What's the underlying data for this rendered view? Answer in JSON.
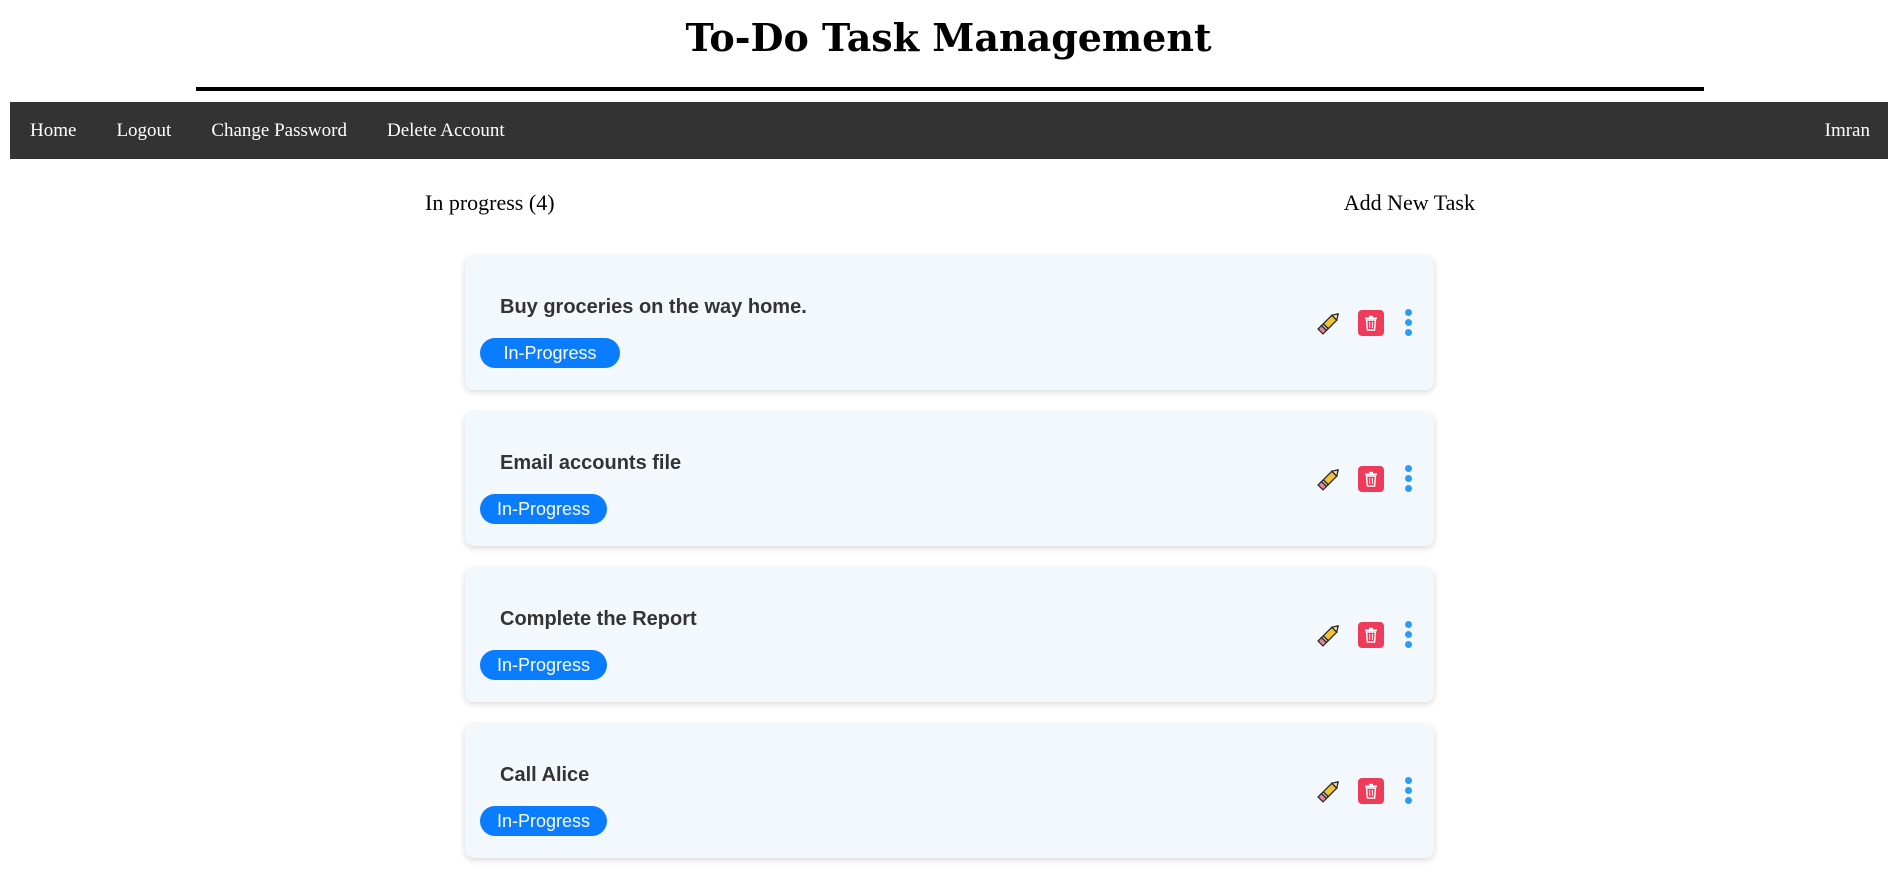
{
  "page": {
    "title": "To-Do Task Management"
  },
  "nav": {
    "items": [
      {
        "label": "Home"
      },
      {
        "label": "Logout"
      },
      {
        "label": "Change Password"
      },
      {
        "label": "Delete Account"
      }
    ],
    "user": "Imran"
  },
  "section": {
    "title": "In progress (4)",
    "add_label": "Add New Task"
  },
  "tasks": [
    {
      "title": "Buy groceries on the way home.",
      "status": "In-Progress"
    },
    {
      "title": "Email accounts file",
      "status": "In-Progress"
    },
    {
      "title": "Complete the Report",
      "status": "In-Progress"
    },
    {
      "title": "Call Alice",
      "status": "In-Progress"
    }
  ],
  "icons": {
    "edit": "pencil-icon",
    "delete": "trash-icon",
    "more": "more-vertical-icon"
  },
  "colors": {
    "navbar": "#333333",
    "badge": "#0a7cff",
    "delete": "#ef3b5a",
    "more": "#2b9df5",
    "card": "#f3f8fd"
  }
}
